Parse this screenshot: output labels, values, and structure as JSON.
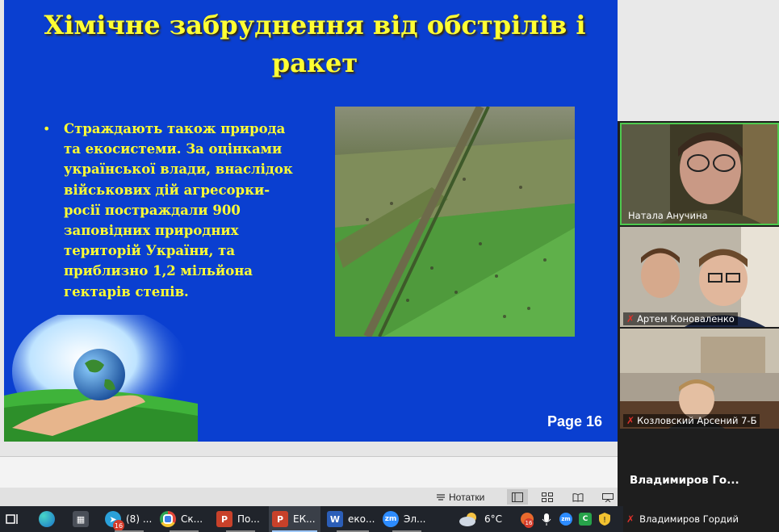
{
  "slide": {
    "title": "Хімічне забруднення від обстрілів і ракет",
    "bullet": "Страждають також природа та екосистеми. За оцінками української влади, внаслідок військових дій агресорки-росії постраждали 900 заповідних природних територій України, та приблизно 1,2 мільйона гектарів степів.",
    "page_label": "Page 16",
    "colors": {
      "background": "#0a3fd0",
      "title": "#ffff33",
      "text": "#ffff33"
    }
  },
  "statusbar": {
    "notes_label": "Нотатки"
  },
  "participants": [
    {
      "name": "Натала Анучина",
      "muted": false,
      "active_speaker": true
    },
    {
      "name": "Артем Коноваленко",
      "muted": true
    },
    {
      "name": "Козловский Арсений 7-Б",
      "muted": true
    },
    {
      "name": "Владимиров Гордий",
      "display_short": "Владимиров  Го...",
      "muted": true,
      "video": false
    }
  ],
  "taskbar": {
    "items": [
      {
        "icon": "task-view-icon",
        "label": ""
      },
      {
        "icon": "edge-icon",
        "label": ""
      },
      {
        "icon": "calculator-icon",
        "label": ""
      },
      {
        "icon": "telegram-icon",
        "label": "(8) ...",
        "badge": "16"
      },
      {
        "icon": "chrome-icon",
        "label": "Ск..."
      },
      {
        "icon": "powerpoint-icon",
        "label": "По..."
      },
      {
        "icon": "powerpoint-icon",
        "label": "ЕК..."
      },
      {
        "icon": "word-icon",
        "label": "еко..."
      },
      {
        "icon": "zoom-icon",
        "label": "Эл..."
      }
    ],
    "weather": "6°C",
    "tray_badge": "16"
  }
}
